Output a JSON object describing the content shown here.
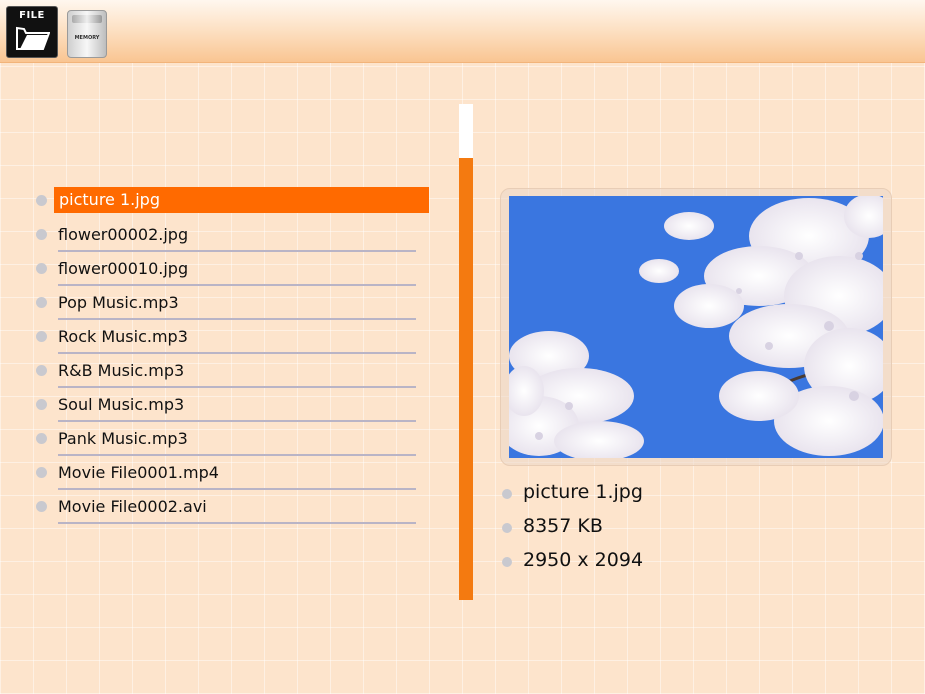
{
  "toolbar": {
    "file_label": "FILE",
    "memory_label": "MEMORY"
  },
  "files": [
    {
      "name": "picture 1.jpg",
      "selected": true
    },
    {
      "name": "flower00002.jpg",
      "selected": false
    },
    {
      "name": "flower00010.jpg",
      "selected": false
    },
    {
      "name": "Pop Music.mp3",
      "selected": false
    },
    {
      "name": "Rock Music.mp3",
      "selected": false
    },
    {
      "name": "R&B Music.mp3",
      "selected": false
    },
    {
      "name": "Soul Music.mp3",
      "selected": false
    },
    {
      "name": "Pank Music.mp3",
      "selected": false
    },
    {
      "name": "Movie File0001.mp4",
      "selected": false
    },
    {
      "name": "Movie File0002.avi",
      "selected": false
    }
  ],
  "details": {
    "filename": "picture 1.jpg",
    "size": "8357 KB",
    "dimensions": "2950 x 2094"
  },
  "colors": {
    "accent": "#ff6a00",
    "scrollbar": "#f47a10",
    "background": "#fde4cc"
  },
  "icons": {
    "file": "folder-icon",
    "memory": "memory-card-icon"
  }
}
